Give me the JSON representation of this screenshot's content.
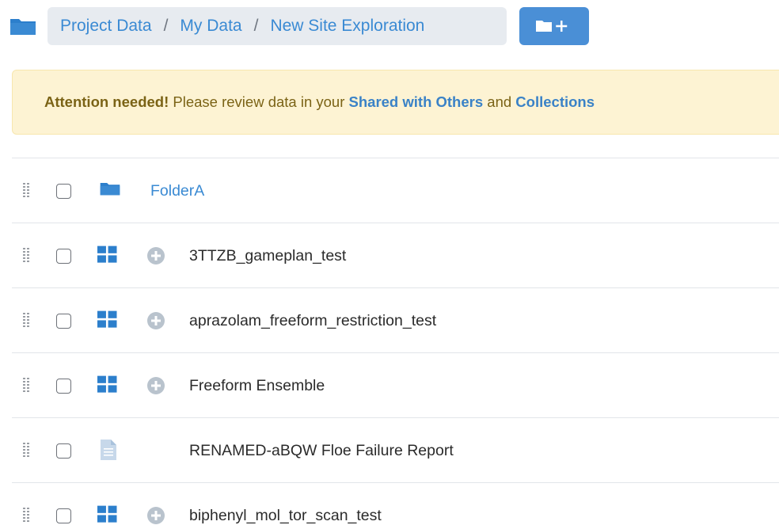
{
  "breadcrumb": {
    "items": [
      {
        "label": "Project Data"
      },
      {
        "label": "My Data"
      },
      {
        "label": "New Site Exploration"
      }
    ],
    "separator": "/"
  },
  "toolbar": {
    "new_folder_icon": "folder-plus-icon"
  },
  "alert": {
    "strong": "Attention needed!",
    "text1": " Please review data in your ",
    "link1": "Shared with Others",
    "text2": " and ",
    "link2": "Collections"
  },
  "rows": [
    {
      "name": "FolderA",
      "type": "folder",
      "icon": "folder-icon"
    },
    {
      "name": "3TTZB_gameplan_test",
      "type": "ensemble",
      "icon": "grid-icon"
    },
    {
      "name": "aprazolam_freeform_restriction_test",
      "type": "ensemble",
      "icon": "grid-icon"
    },
    {
      "name": "Freeform Ensemble",
      "type": "ensemble",
      "icon": "grid-icon"
    },
    {
      "name": "RENAMED-aBQW Floe Failure Report",
      "type": "document",
      "icon": "document-icon"
    },
    {
      "name": "biphenyl_mol_tor_scan_test",
      "type": "ensemble",
      "icon": "grid-icon"
    }
  ],
  "colors": {
    "accent": "#3a8ad3",
    "button": "#4a8fd6",
    "alert_bg": "#fdf3d3",
    "alert_text": "#7b6316"
  }
}
